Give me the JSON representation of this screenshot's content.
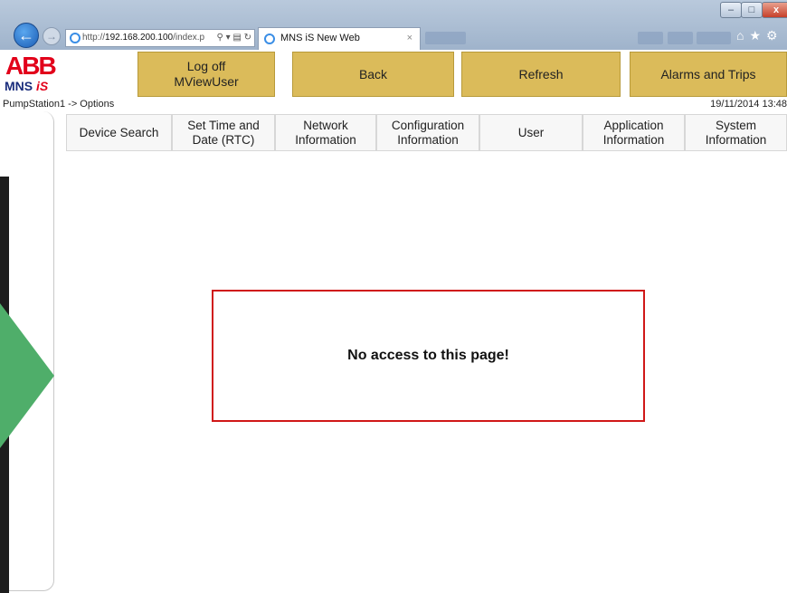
{
  "browser": {
    "window_controls": {
      "minimize": "–",
      "maximize": "□",
      "close": "x"
    },
    "address": {
      "prefix": "http://",
      "host": "192.168.200.100",
      "path": "/index.p",
      "tools": "⚲ ▾ ▤ ↻"
    },
    "tab": {
      "title": "MNS iS New Web",
      "close": "×"
    },
    "toolbar_icons": "⌂★⚙"
  },
  "logo": {
    "brand": "ABB",
    "product": "MNS",
    "product_suffix": "iS"
  },
  "header_buttons": {
    "logoff": "Log off\nMViewUser",
    "back": "Back",
    "refresh": "Refresh",
    "alarms": "Alarms and Trips"
  },
  "breadcrumb": "PumpStation1 -> Options",
  "datetime": "19/11/2014 13:48",
  "option_tabs": [
    "Device Search",
    "Set Time and Date (RTC)",
    "Network Information",
    "Configuration Information",
    "User",
    "Application Information",
    "System Information"
  ],
  "message": "No access to this page!",
  "colors": {
    "button_bg": "#dbbb5a",
    "message_border": "#d01818",
    "side_arrow": "#4fae6a",
    "abb_red": "#e2001a"
  }
}
